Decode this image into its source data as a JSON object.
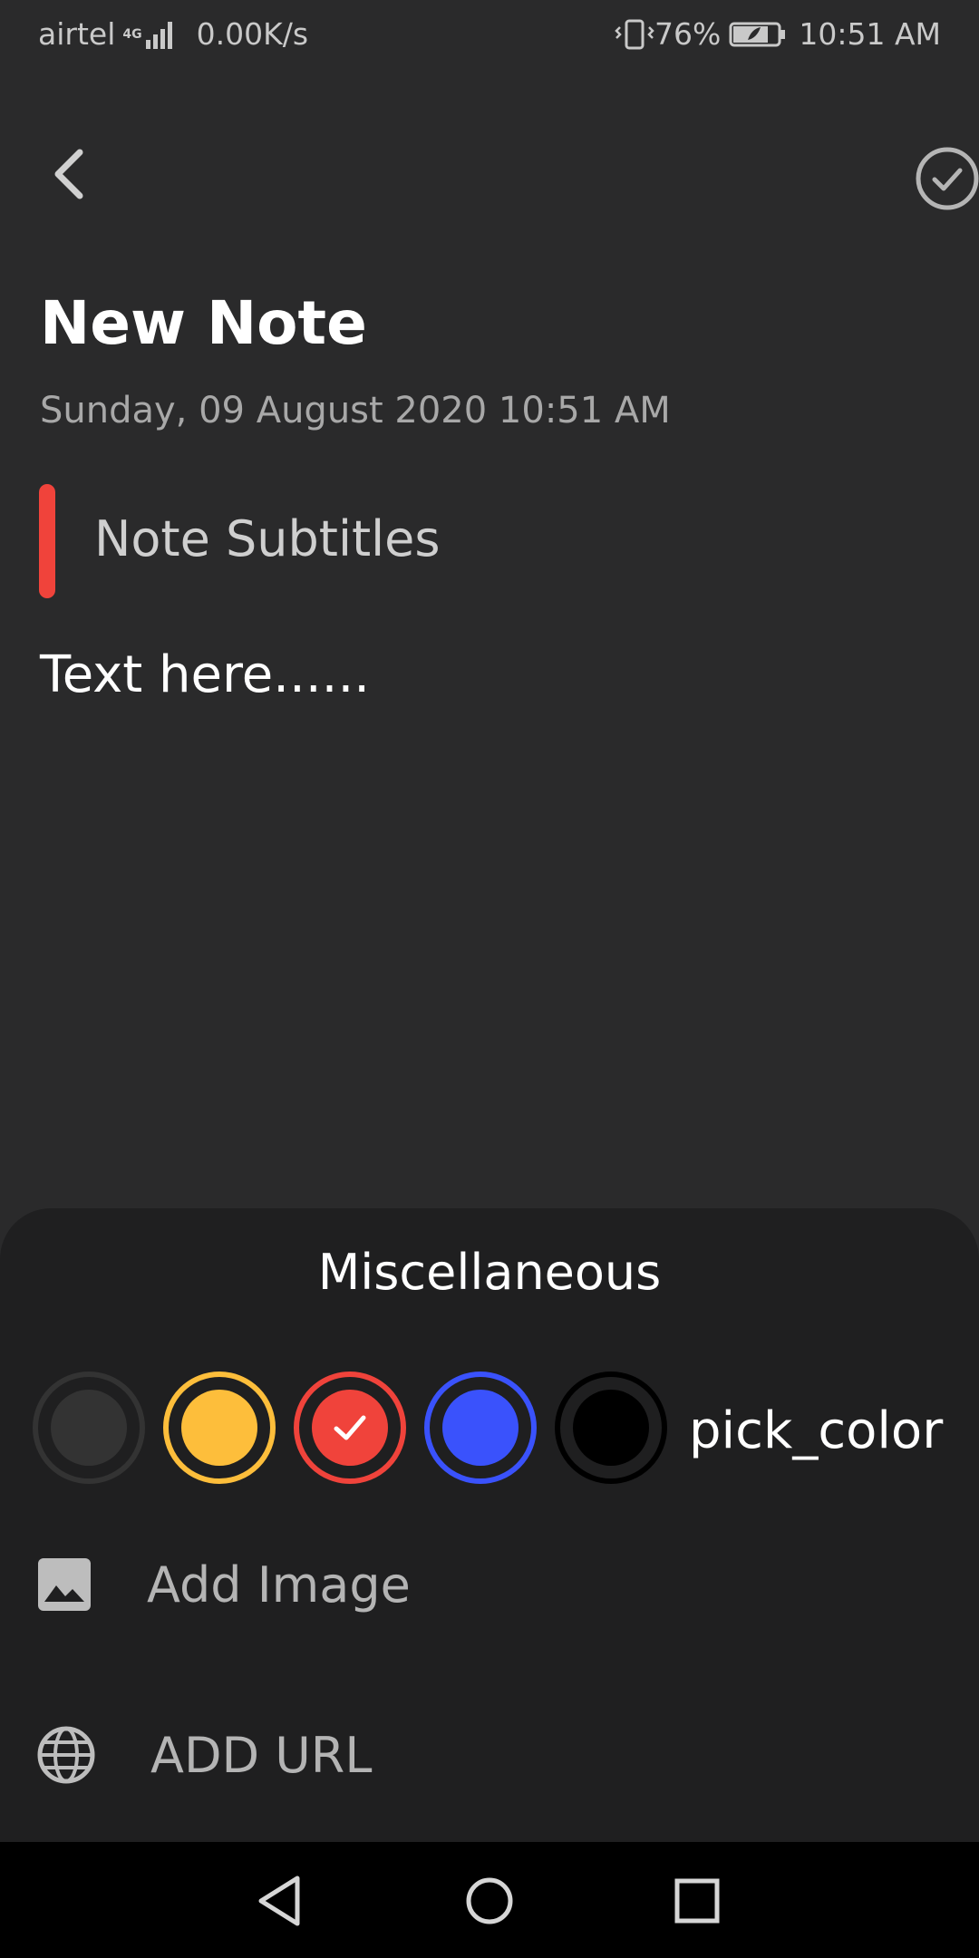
{
  "status_bar": {
    "carrier": "airtel",
    "network_type": "4G",
    "speed": "0.00K/s",
    "battery": "76%",
    "time": "10:51 AM"
  },
  "note": {
    "title": "New Note",
    "datetime": "Sunday, 09 August 2020 10:51 AM",
    "subtitle": "Note Subtitles",
    "body": "Text here......",
    "indicator_color": "#f0433b"
  },
  "misc": {
    "title": "Miscellaneous",
    "pick_color_label": "pick_color",
    "colors": [
      {
        "name": "default",
        "color": "#333333",
        "selected": false
      },
      {
        "name": "yellow",
        "color": "#fdbe3b",
        "selected": false
      },
      {
        "name": "red",
        "color": "#f0433b",
        "selected": true
      },
      {
        "name": "blue",
        "color": "#3a52fc",
        "selected": false
      },
      {
        "name": "black",
        "color": "#000000",
        "selected": false
      }
    ],
    "add_image_label": "Add Image",
    "add_url_label": "ADD URL"
  }
}
